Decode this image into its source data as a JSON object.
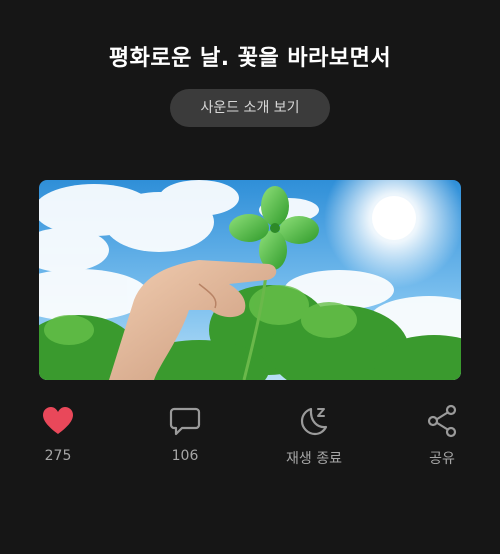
{
  "header": {
    "title": "평화로운 날. 꽃을 바라보면서",
    "sound_intro_label": "사운드 소개 보기"
  },
  "hero_image": {
    "description_icon": "four-leaf-clover-photo"
  },
  "actions": {
    "like": {
      "icon": "heart-icon",
      "count": "275",
      "color": "#e9485a"
    },
    "comment": {
      "icon": "comment-icon",
      "count": "106"
    },
    "sleep_timer": {
      "icon": "moon-sleep-icon",
      "label": "재생 종료"
    },
    "share": {
      "icon": "share-icon",
      "label": "공유"
    }
  },
  "colors": {
    "background": "#161616",
    "button_bg": "#3b3b3b",
    "muted_text": "#a6a6a6",
    "icon_stroke": "#9a9a9a",
    "like_red": "#e9485a"
  }
}
